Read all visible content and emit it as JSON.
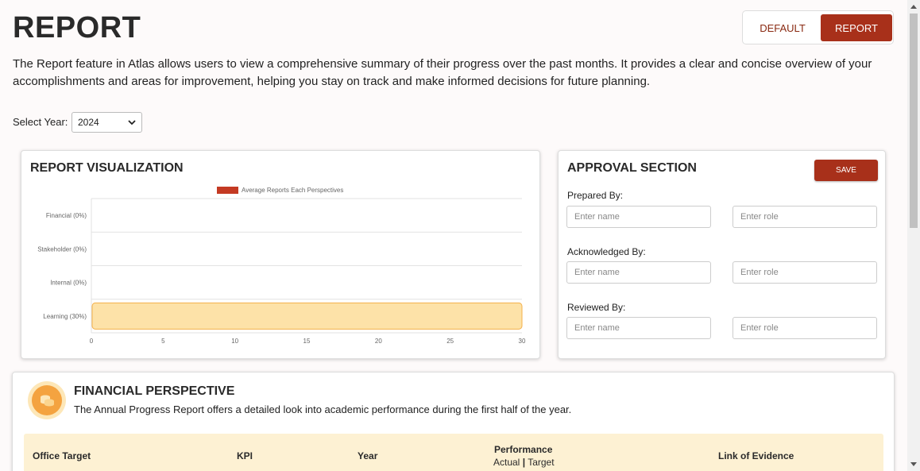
{
  "header": {
    "title": "REPORT",
    "toggle_default": "DEFAULT",
    "toggle_report": "REPORT"
  },
  "description": "The Report feature in Atlas allows users to view a comprehensive summary of their progress over the past months. It provides a clear and concise overview of your accomplishments and areas for improvement, helping you stay on track and make informed decisions for future planning.",
  "year_filter": {
    "label": "Select Year:",
    "selected": "2024"
  },
  "visualization": {
    "title": "REPORT VISUALIZATION"
  },
  "chart_data": {
    "type": "bar",
    "orientation": "horizontal",
    "categories": [
      "Financial (0%)",
      "Stakeholder (0%)",
      "Internal (0%)",
      "Learning (30%)"
    ],
    "series": [
      {
        "name": "Average Reports Each Perspectives",
        "values": [
          0,
          0,
          0,
          30
        ]
      }
    ],
    "xlim": [
      0,
      30
    ],
    "xticks": [
      "0",
      "5",
      "10",
      "15",
      "20",
      "25",
      "30"
    ],
    "grid": true,
    "legend": "top",
    "colors": {
      "legend": "#c43a23",
      "bar_fill": "#fde2a8",
      "bar_border": "#f4b04a"
    }
  },
  "approval": {
    "title": "APPROVAL SECTION",
    "save_label": "SAVE",
    "groups": [
      {
        "label": "Prepared By:",
        "name_placeholder": "Enter name",
        "role_placeholder": "Enter role"
      },
      {
        "label": "Acknowledged By:",
        "name_placeholder": "Enter name",
        "role_placeholder": "Enter role"
      },
      {
        "label": "Reviewed By:",
        "name_placeholder": "Enter name",
        "role_placeholder": "Enter role"
      }
    ]
  },
  "financial": {
    "title": "FINANCIAL PERSPECTIVE",
    "subtitle": "The Annual Progress Report offers a detailed look into academic performance during the first half of the year.",
    "icon": "coins-icon",
    "columns": {
      "office_target": "Office Target",
      "kpi": "KPI",
      "year": "Year",
      "performance": "Performance",
      "actual": "Actual",
      "separator": "|",
      "target": "Target",
      "evidence": "Link of Evidence"
    }
  },
  "colors": {
    "accent": "#a8301a",
    "header_bg": "#fdf1d3"
  }
}
